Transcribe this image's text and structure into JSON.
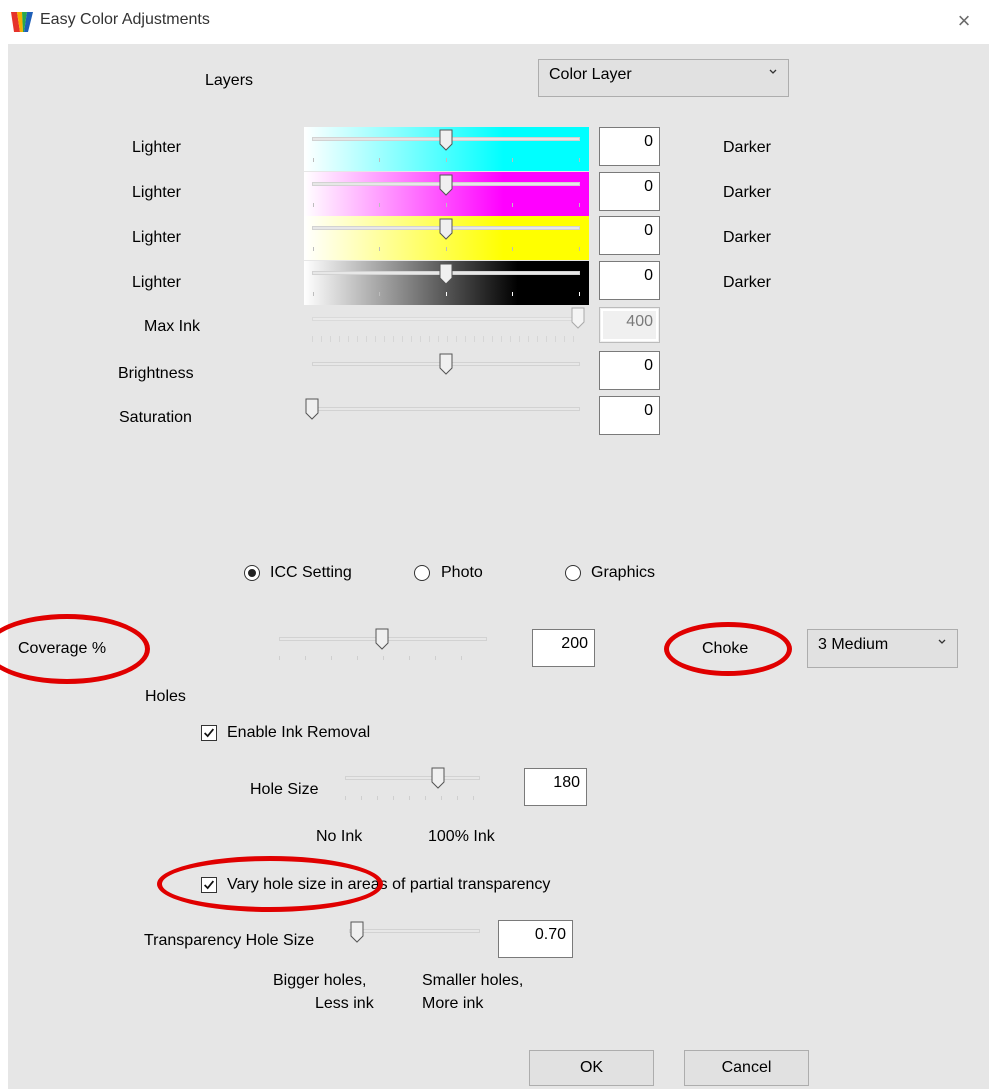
{
  "window": {
    "title": "Easy Color Adjustments",
    "close_glyph": "×"
  },
  "layers": {
    "label": "Layers",
    "selected": "Color Layer"
  },
  "sliders": {
    "rows": [
      {
        "left": "Lighter",
        "right": "Darker",
        "value": "0",
        "color": "#00ffff"
      },
      {
        "left": "Lighter",
        "right": "Darker",
        "value": "0",
        "color": "#ff00ff"
      },
      {
        "left": "Lighter",
        "right": "Darker",
        "value": "0",
        "color": "#ffff00"
      },
      {
        "left": "Lighter",
        "right": "Darker",
        "value": "0",
        "color": "#000000"
      }
    ],
    "max_ink": {
      "label": "Max Ink",
      "value": "400",
      "disabled": true
    },
    "brightness": {
      "label": "Brightness",
      "value": "0"
    },
    "saturation": {
      "label": "Saturation",
      "value": "0"
    }
  },
  "mode": {
    "options": [
      "ICC Setting",
      "Photo",
      "Graphics"
    ],
    "selected": "ICC Setting"
  },
  "coverage": {
    "label": "Coverage %",
    "value": "200"
  },
  "choke": {
    "label": "Choke",
    "selected": "3 Medium"
  },
  "holes": {
    "label": "Holes",
    "enable_ink_removal": {
      "label": "Enable Ink Removal",
      "checked": true
    },
    "hole_size": {
      "label": "Hole Size",
      "value": "180"
    },
    "scale_left": "No Ink",
    "scale_right": "100% Ink",
    "vary": {
      "label": "Vary hole size in areas of partial transparency",
      "checked": true
    },
    "transparency_hole_size": {
      "label": "Transparency Hole Size",
      "value": "0.70"
    },
    "bigger_label_1": "Bigger holes,",
    "bigger_label_2": "Less ink",
    "smaller_label_1": "Smaller holes,",
    "smaller_label_2": "More ink"
  },
  "buttons": {
    "ok": "OK",
    "cancel": "Cancel"
  },
  "annotation_color": "#e00000"
}
